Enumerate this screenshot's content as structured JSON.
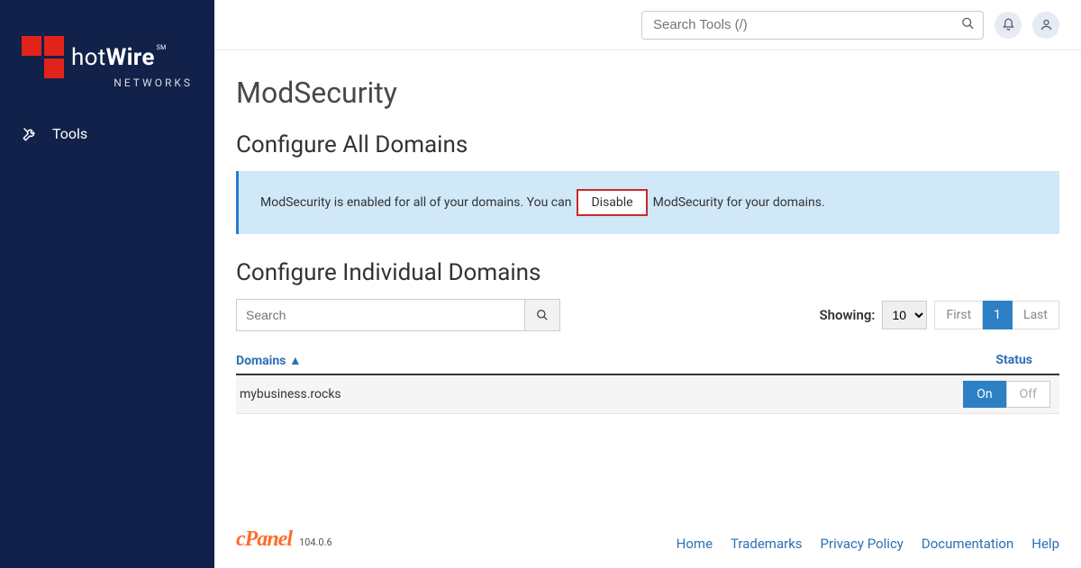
{
  "brand": {
    "name_html_prefix": "hot",
    "name_html_bold": "Wire",
    "suffix": "NETWORKS",
    "mark": "SM"
  },
  "sidebar": {
    "tools_label": "Tools"
  },
  "header": {
    "search_placeholder": "Search Tools (/)"
  },
  "page": {
    "title": "ModSecurity",
    "configure_all_heading": "Configure All Domains",
    "info_pre": "ModSecurity is enabled for all of your domains. You can",
    "disable_label": "Disable",
    "info_post": "ModSecurity for your domains.",
    "configure_individual_heading": "Configure Individual Domains",
    "domain_search_placeholder": "Search",
    "showing_label": "Showing:",
    "page_size_selected": "10",
    "pager_first": "First",
    "pager_page": "1",
    "pager_last": "Last",
    "col_domains": "Domains ▲",
    "col_status": "Status",
    "rows": [
      {
        "domain": "mybusiness.rocks",
        "on_label": "On",
        "off_label": "Off"
      }
    ]
  },
  "footer": {
    "brand": "cPanel",
    "version": "104.0.6",
    "links": {
      "home": "Home",
      "trademarks": "Trademarks",
      "privacy": "Privacy Policy",
      "docs": "Documentation",
      "help": "Help"
    }
  }
}
